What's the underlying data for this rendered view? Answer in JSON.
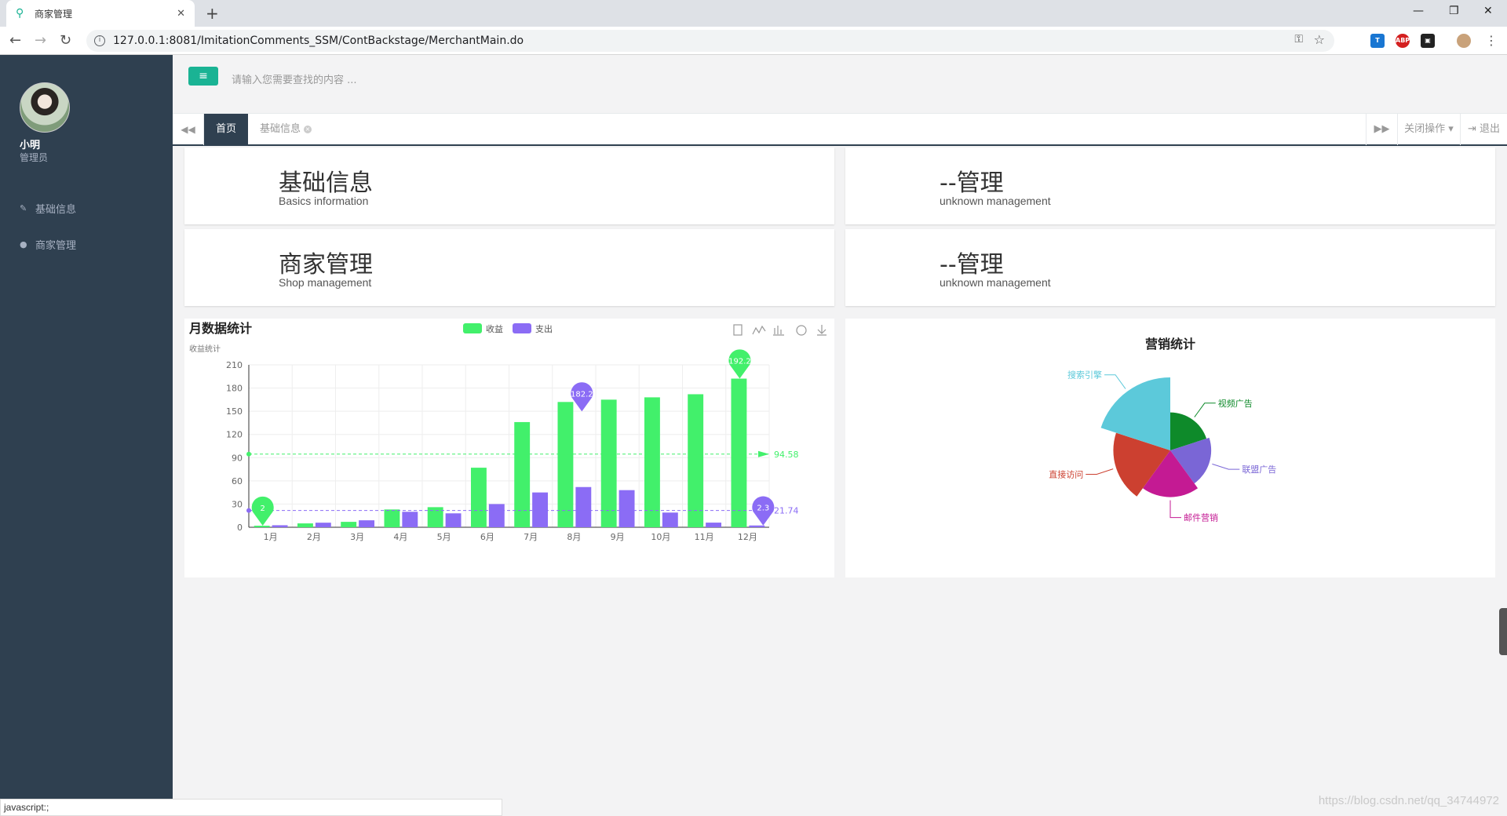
{
  "browser": {
    "tab_title": "商家管理",
    "url": "127.0.0.1:8081/ImitationComments_SSM/ContBackstage/MerchantMain.do",
    "status_text": "javascript:;",
    "watermark": "https://blog.csdn.net/qq_34744972"
  },
  "sidebar": {
    "user_name": "小明",
    "user_role": "管理员",
    "items": [
      {
        "label": "基础信息",
        "icon": "edit-icon"
      },
      {
        "label": "商家管理",
        "icon": "user-icon"
      }
    ]
  },
  "topnav": {
    "search_placeholder": "请输入您需要查找的内容 ..."
  },
  "content_tabs": {
    "tabs": [
      {
        "label": "首页"
      },
      {
        "label": "基础信息"
      }
    ],
    "close_ops": "关闭操作",
    "logout": "退出"
  },
  "cards": [
    {
      "title": "基础信息",
      "subtitle": "Basics information"
    },
    {
      "title": "--管理",
      "subtitle": "unknown management"
    },
    {
      "title": "商家管理",
      "subtitle": "Shop management"
    },
    {
      "title": "--管理",
      "subtitle": "unknown management"
    }
  ],
  "colors": {
    "income": "#42f06b",
    "expense": "#8b6cf5",
    "sidebar": "#2f4050",
    "accent": "#1ab394"
  },
  "chart_data": [
    {
      "type": "bar",
      "title": "月数据统计",
      "subtitle": "收益统计",
      "categories": [
        "1月",
        "2月",
        "3月",
        "4月",
        "5月",
        "6月",
        "7月",
        "8月",
        "9月",
        "10月",
        "11月",
        "12月"
      ],
      "series": [
        {
          "name": "收益",
          "values": [
            2,
            5,
            7,
            23,
            26,
            77,
            136,
            162,
            165,
            168,
            172,
            192.2
          ]
        },
        {
          "name": "支出",
          "values": [
            2.6,
            5.9,
            9,
            20,
            18,
            30,
            45,
            52,
            48,
            19,
            6,
            2.3
          ]
        }
      ],
      "ylim": [
        0,
        210
      ],
      "yticks": [
        0,
        30,
        60,
        90,
        120,
        150,
        180,
        210
      ],
      "mark_points": {
        "income_max": "192.2",
        "income_min": "2",
        "expense_max": "182.2",
        "expense_min": "2.3"
      },
      "mark_lines": {
        "income_avg": "94.58",
        "expense_avg": "21.74"
      },
      "legend": "top-center",
      "grid": true,
      "toolbox": [
        "data-view-icon",
        "line-chart-icon",
        "bar-chart-icon",
        "refresh-icon",
        "download-icon"
      ]
    },
    {
      "type": "pie",
      "title": "营销统计",
      "rose": true,
      "slices": [
        {
          "name": "视频广告",
          "value": 11,
          "color": "#0e8a2a"
        },
        {
          "name": "联盟广告",
          "value": 13,
          "color": "#7a66d6"
        },
        {
          "name": "邮件营销",
          "value": 17,
          "color": "#c41a93"
        },
        {
          "name": "直接访问",
          "value": 24,
          "color": "#cc4030"
        },
        {
          "name": "搜索引擎",
          "value": 35,
          "color": "#5cc9da"
        }
      ]
    }
  ]
}
